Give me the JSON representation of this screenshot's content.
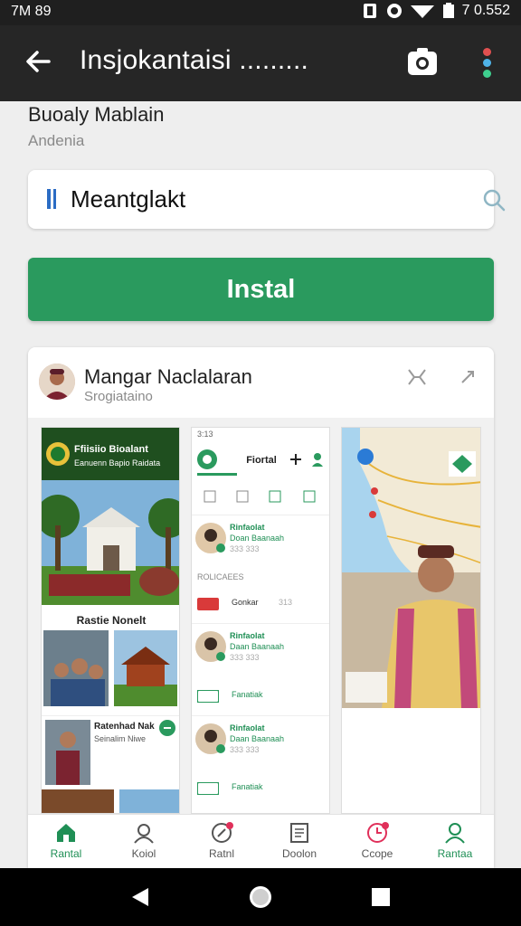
{
  "status_bar": {
    "time": "7M 89",
    "right_text": "7 0.552",
    "icons": [
      "nfc-icon",
      "vibrate-icon",
      "wifi-icon",
      "battery-icon"
    ]
  },
  "app_bar": {
    "title": "Insjokantaisi .........",
    "back_icon": "arrow-left-icon",
    "camera_icon": "camera-icon",
    "menu_icon": "more-vert-icon",
    "menu_dot_colors": [
      "#e05050",
      "#4fb3e8",
      "#3ecf8e"
    ]
  },
  "header": {
    "name": "Buoaly Mablain",
    "sub": "Andenia"
  },
  "search": {
    "value": "Meantglakt",
    "icon": "search-icon"
  },
  "install_label": "Instal",
  "colors": {
    "accent": "#2a9a5e",
    "app_bar": "#262626",
    "fab": "#e0305a"
  },
  "card": {
    "name": "Mangar Naclalaran",
    "sub": "Srogiataino",
    "shot1": {
      "header_title": "Ffiisiio Bioalant",
      "header_sub": "Eanuenn Bapio Raidata",
      "section_title": "Rastie Nonelt",
      "item_title": "Ratenhad Nak",
      "item_sub": "Seinalim Niwe"
    },
    "shot2": {
      "time": "3:13",
      "tab_title": "Fiortal",
      "section_label": "ROLICAEES",
      "rows": [
        {
          "title": "Rinfaolat",
          "sub": "Doan Baanaah",
          "meta": "333 333",
          "tag": "Gonkar",
          "tag_meta": "313"
        },
        {
          "title": "Rinfaolat",
          "sub": "Daan Baanaah",
          "meta": "333 333",
          "tag": "Fanatiak",
          "tag_meta": ""
        },
        {
          "title": "Rinfaolat",
          "sub": "Daan Baanaah",
          "meta": "333 333",
          "tag": "Fanatiak",
          "tag_meta": ""
        }
      ]
    },
    "shot3": {
      "fab_label": "+"
    }
  },
  "bottom_nav": [
    {
      "label": "Rantal",
      "icon": "home-icon",
      "active": true
    },
    {
      "label": "Koiol",
      "icon": "people-icon",
      "active": false
    },
    {
      "label": "Ratnl",
      "icon": "compass-icon",
      "active": false
    },
    {
      "label": "Doolon",
      "icon": "document-icon",
      "active": false
    },
    {
      "label": "Ccope",
      "icon": "clock-icon",
      "active": false
    },
    {
      "label": "Rantaa",
      "icon": "person-icon",
      "active": true
    }
  ],
  "system_nav": [
    "back-triangle-icon",
    "home-circle-icon",
    "recents-square-icon"
  ]
}
